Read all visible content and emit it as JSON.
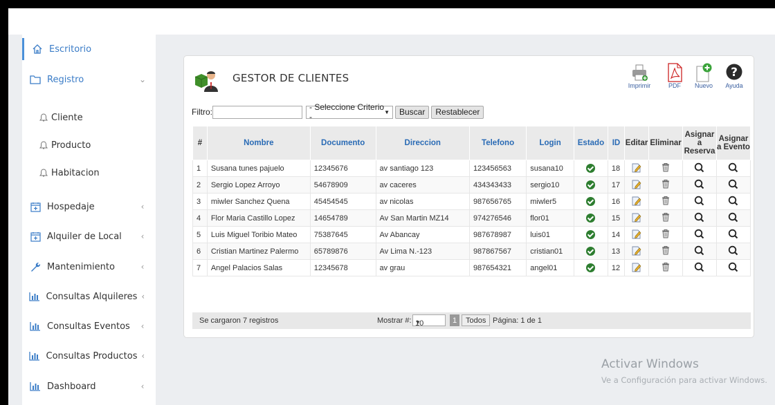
{
  "sidebar": {
    "items": [
      {
        "label": "Escritorio",
        "icon": "home-icon"
      },
      {
        "label": "Registro",
        "icon": "folder-icon",
        "arrow": "⌄"
      },
      {
        "label": "Hospedaje",
        "icon": "calendar-icon",
        "arrow": "‹"
      },
      {
        "label": "Alquiler de Local",
        "icon": "calendar-icon",
        "arrow": "‹"
      },
      {
        "label": "Mantenimiento",
        "icon": "wrench-icon",
        "arrow": "‹"
      },
      {
        "label": "Consultas Alquileres",
        "icon": "bar-chart-icon",
        "arrow": "‹"
      },
      {
        "label": "Consultas Eventos",
        "icon": "bar-chart-icon",
        "arrow": "‹"
      },
      {
        "label": "Consultas Productos",
        "icon": "bar-chart-icon",
        "arrow": "‹"
      },
      {
        "label": "Dashboard",
        "icon": "bar-chart-icon",
        "arrow": "‹"
      }
    ],
    "sub_items": [
      {
        "label": "Cliente",
        "icon": "bell-icon"
      },
      {
        "label": "Producto",
        "icon": "bell-icon"
      },
      {
        "label": "Habitacion",
        "icon": "bell-icon"
      }
    ]
  },
  "panel": {
    "title": "GESTOR DE CLIENTES",
    "tools": [
      "Imprimir",
      "PDF",
      "Nuevo",
      "Ayuda"
    ]
  },
  "filter": {
    "label": "Filtro:",
    "value": "",
    "criteria": "- Seleccione Criterio -",
    "search_label": "Buscar",
    "reset_label": "Restablecer"
  },
  "table": {
    "headers": [
      "#",
      "Nombre",
      "Documento",
      "Direccion",
      "Telefono",
      "Login",
      "Estado",
      "ID",
      "Editar",
      "Eliminar",
      "Asignar a Reserva",
      "Asignar a Evento"
    ],
    "rows": [
      [
        "1",
        "Susana tunes pajuelo",
        "12345676",
        "av santiago 123",
        "123456563",
        "susana10",
        "18"
      ],
      [
        "2",
        "Sergio Lopez Arroyo",
        "54678909",
        "av caceres",
        "434343433",
        "sergio10",
        "17"
      ],
      [
        "3",
        "miwler Sanchez Quena",
        "45454545",
        "av nicolas",
        "987656765",
        "miwler5",
        "16"
      ],
      [
        "4",
        "Flor Maria Castillo Lopez",
        "14654789",
        "Av San Martin MZ14",
        "974276546",
        "flor01",
        "15"
      ],
      [
        "5",
        "Luis Miguel Toribio Mateo",
        "75387645",
        "Av Abancay",
        "987678987",
        "luis01",
        "14"
      ],
      [
        "6",
        "Cristian Martinez Palermo",
        "65789876",
        "Av Lima N.-123",
        "987867567",
        "cristian01",
        "13"
      ],
      [
        "7",
        "Angel Palacios Salas",
        "12345678",
        "av grau",
        "987654321",
        "angel01",
        "12"
      ]
    ]
  },
  "footer": {
    "status": "Se cargaron 7 registros",
    "show_label": "Mostrar #:",
    "show_value": "10",
    "page_button": "1",
    "all_label": "Todos",
    "page_text": "Página: 1 de 1"
  },
  "watermark": {
    "title": "Activar Windows",
    "subtitle": "Ve a Configuración para activar Windows."
  },
  "colors": {
    "accent": "#2a6bb5",
    "active_border": "#4a90d9",
    "status_ok": "#2d7d2f"
  }
}
